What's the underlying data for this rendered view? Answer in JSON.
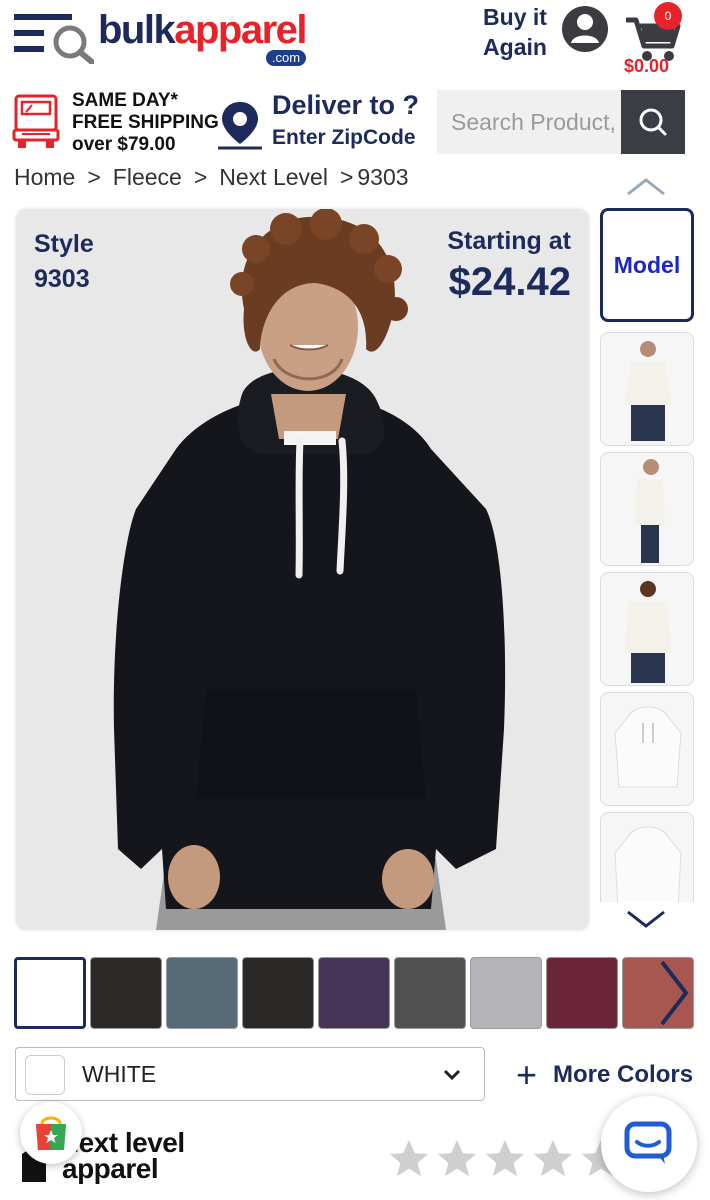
{
  "header": {
    "logo_primary": "bulk",
    "logo_secondary": "apparel",
    "logo_domain": ".com",
    "buy_again_line1": "Buy it",
    "buy_again_line2": "Again",
    "cart_count": "0",
    "cart_total": "$0.00"
  },
  "shipping": {
    "line1": "SAME DAY*",
    "line2": "FREE SHIPPING",
    "line3": "over $79.00",
    "deliver_title": "Deliver to ?",
    "deliver_sub": "Enter ZipCode"
  },
  "search": {
    "placeholder": "Search Product, B"
  },
  "breadcrumb": {
    "items": [
      "Home",
      "Fleece",
      "Next Level",
      "9303"
    ],
    "separator": ">"
  },
  "product": {
    "style_label": "Style",
    "style_number": "9303",
    "price_label": "Starting at",
    "price": "$24.42"
  },
  "thumbnails": {
    "active_label": "Model",
    "items": [
      "model",
      "front-white",
      "side-white",
      "back-white",
      "flat-front",
      "flat-back"
    ]
  },
  "swatches": {
    "colors": [
      "#ffffff",
      "#2c2a29",
      "#566a77",
      "#2a2826",
      "#453457",
      "#505050",
      "#b4b4b8",
      "#6a2538",
      "#a7574f"
    ],
    "selected_index": 0
  },
  "color_select": {
    "value": "WHITE",
    "more_colors": "More Colors"
  },
  "brand": {
    "line1": "next level",
    "line2": "apparel"
  },
  "rating": {
    "stars": 5,
    "filled": 0
  },
  "colors": {
    "navy": "#1d2a5c",
    "red": "#e6232a",
    "search_btn": "#3b3d44"
  }
}
